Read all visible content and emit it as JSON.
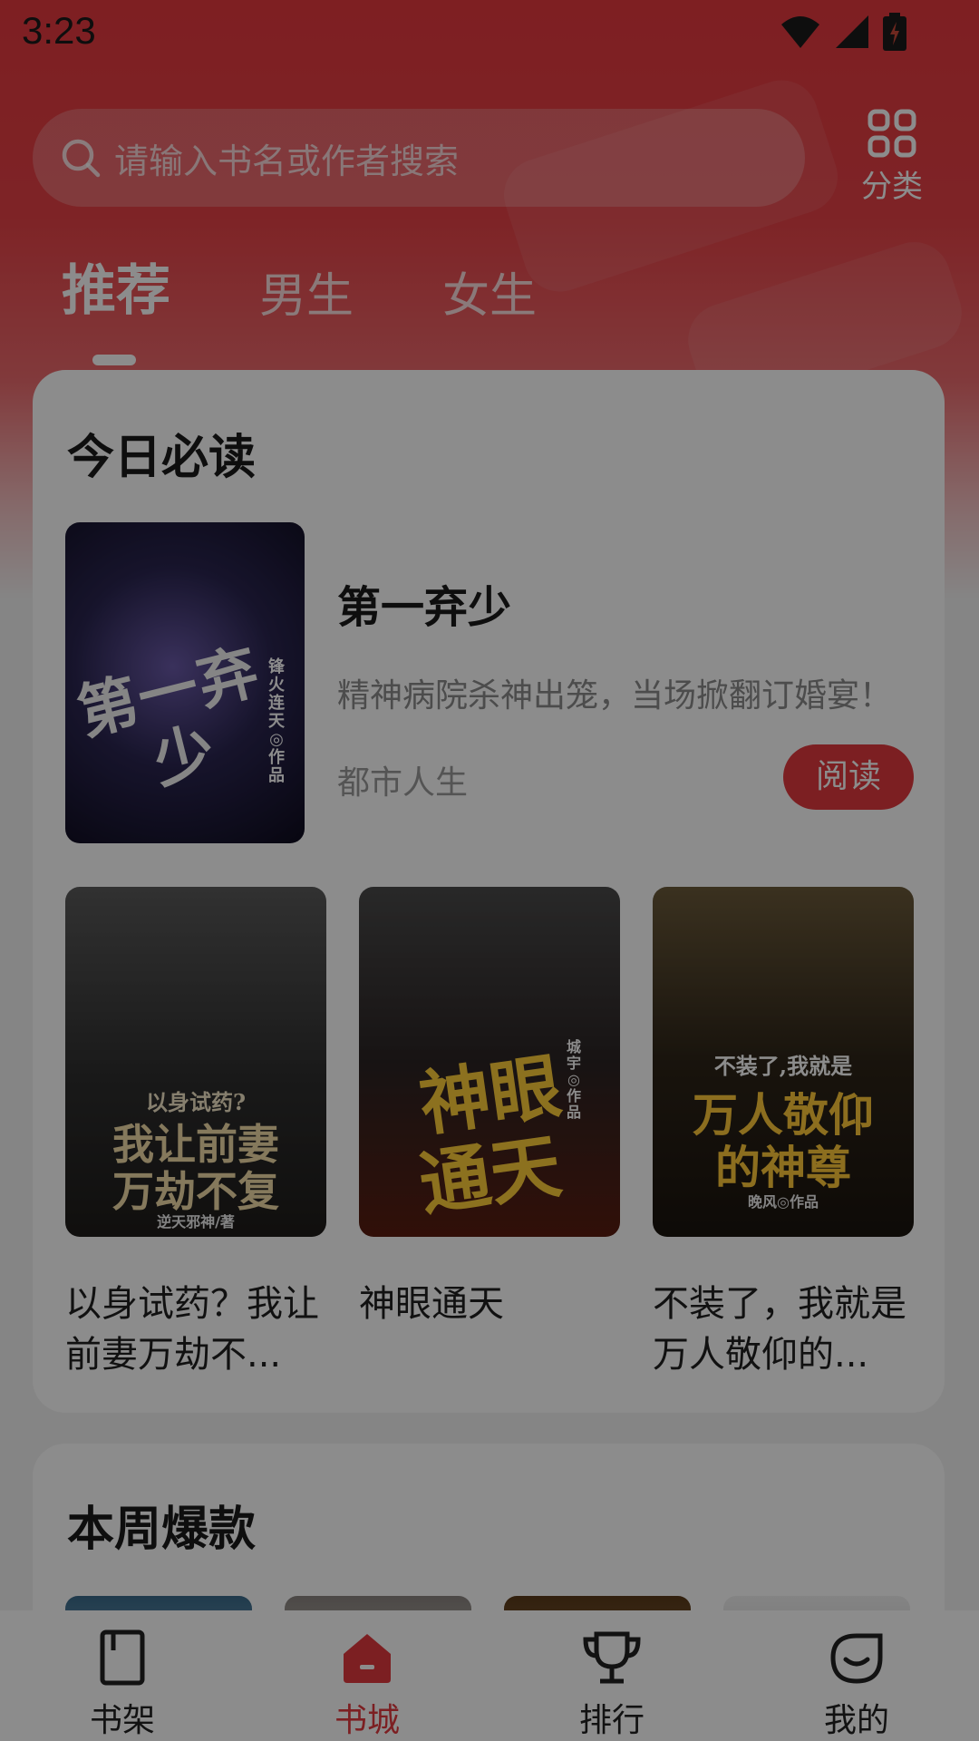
{
  "status_bar": {
    "time": "3:23"
  },
  "search": {
    "placeholder": "请输入书名或作者搜索"
  },
  "category": {
    "label": "分类"
  },
  "tabs": [
    {
      "label": "推荐",
      "active": true
    },
    {
      "label": "男生",
      "active": false
    },
    {
      "label": "女生",
      "active": false
    }
  ],
  "daily_section": {
    "title": "今日必读",
    "featured": {
      "name": "第一弃少",
      "description": "精神病院杀神出笼，当场掀翻订婚宴！",
      "genre": "都市人生",
      "read_label": "阅读",
      "cover_title": "第一弃少",
      "cover_author": "锋火连天◎作品"
    },
    "books": [
      {
        "title": "以身试药？我让前妻万劫不...",
        "cover_title_1": "以身试药?",
        "cover_title_2": "我让前妻",
        "cover_title_3": "万劫不复",
        "cover_author": "逆天邪神/著"
      },
      {
        "title": "神眼通天",
        "cover_title_1": "神眼",
        "cover_title_2": "通天",
        "cover_author": "城宇◎作品"
      },
      {
        "title": "不装了，我就是万人敬仰的...",
        "cover_title_1": "不装了,我就是",
        "cover_title_2": "万人敬仰",
        "cover_title_3": "的神尊",
        "cover_author": "晚风◎作品"
      }
    ]
  },
  "weekly_section": {
    "title": "本周爆款"
  },
  "bottom_nav": [
    {
      "label": "书架",
      "icon": "book-icon",
      "active": false
    },
    {
      "label": "书城",
      "icon": "home-icon",
      "active": true
    },
    {
      "label": "排行",
      "icon": "trophy-icon",
      "active": false
    },
    {
      "label": "我的",
      "icon": "profile-icon",
      "active": false
    }
  ],
  "colors": {
    "brand": "#e23a3f",
    "header_gradient": "#e5393f"
  }
}
